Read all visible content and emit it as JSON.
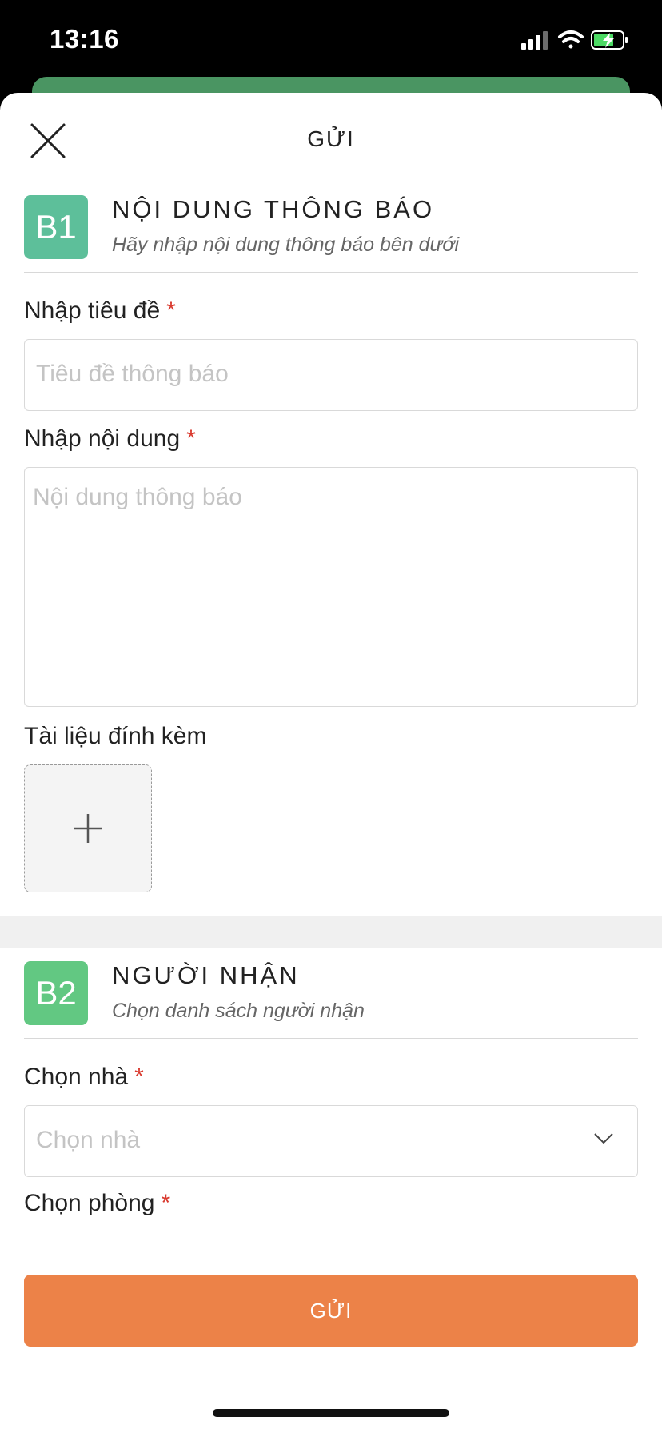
{
  "status_bar": {
    "time": "13:16"
  },
  "header": {
    "title": "GỬI"
  },
  "section1": {
    "badge": "B1",
    "title": "NỘI DUNG THÔNG BÁO",
    "subtitle": "Hãy nhập nội dung thông báo bên dưới"
  },
  "fields": {
    "title_label": "Nhập tiêu đề",
    "title_placeholder": "Tiêu đề thông báo",
    "content_label": "Nhập nội dung",
    "content_placeholder": "Nội dung thông báo",
    "attachment_label": "Tài liệu đính kèm",
    "required_mark": "*"
  },
  "section2": {
    "badge": "B2",
    "title": "NGƯỜI NHẬN",
    "subtitle": "Chọn danh sách người nhận"
  },
  "recipient": {
    "house_label": "Chọn nhà",
    "house_placeholder": "Chọn nhà",
    "room_label": "Chọn phòng"
  },
  "submit": {
    "label": "GỬI"
  },
  "colors": {
    "badge_b1": "#5dbf9a",
    "badge_b2": "#62c882",
    "submit": "#ec8248",
    "required": "#d93a2f"
  }
}
